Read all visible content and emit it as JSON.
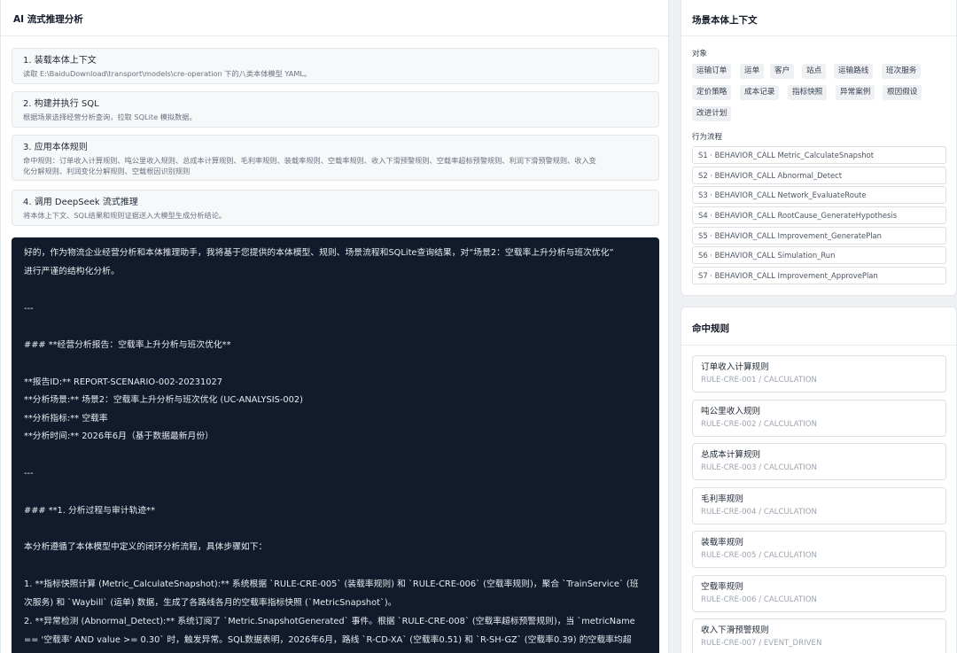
{
  "left": {
    "title": "AI 流式推理分析",
    "steps": [
      {
        "title": "1. 装载本体上下文",
        "desc": "读取 E:\\BaiduDownload\\transport\\models\\cre-operation 下的八类本体模型 YAML。"
      },
      {
        "title": "2. 构建并执行 SQL",
        "desc": "根据场景选择经营分析查询，拉取 SQLite 模拟数据。"
      },
      {
        "title": "3. 应用本体规则",
        "desc": "命中规则：订单收入计算规则、吨公里收入规则、总成本计算规则、毛利率规则、装载率规则、空载率规则、收入下滑预警规则、空载率超标预警规则、利润下滑预警规则、收入变",
        "desc2": "化分解规则、利润变化分解规则、空载根因识别规则"
      },
      {
        "title": "4. 调用 DeepSeek 流式推理",
        "desc": "将本体上下文、SQL结果和规则证据送入大模型生成分析结论。"
      }
    ],
    "output_lines": [
      "好的，作为物流企业经营分析和本体推理助手，我将基于您提供的本体模型、规则、场景流程和SQLite查询结果，对“场景2：空载率上升分析与班次优化”",
      "进行严谨的结构化分析。",
      "---",
      "### **经营分析报告：空载率上升分析与班次优化**",
      "**报告ID:** REPORT-SCENARIO-002-20231027",
      "**分析场景:** 场景2：空载率上升分析与班次优化 (UC-ANALYSIS-002)",
      "**分析指标:** 空载率",
      "**分析时间:** 2026年6月（基于数据最新月份）",
      "---",
      "### **1. 分析过程与审计轨迹**",
      "本分析遵循了本体模型中定义的闭环分析流程，具体步骤如下：",
      "1. **指标快照计算 (Metric_CalculateSnapshot):** 系统根据 `RULE-CRE-005` (装载率规则) 和 `RULE-CRE-006` (空载率规则)，聚合 `TrainService` (班",
      "次服务) 和 `Waybill` (运单) 数据，生成了各路线各月的空载率指标快照 (`MetricSnapshot`)。",
      "2. **异常检测 (Abnormal_Detect):** 系统订阅了 `Metric.SnapshotGenerated` 事件。根据 `RULE-CRE-008` (空载率超标预警规则)，当 `metricName",
      "== '空载率' AND value >= 0.30` 时，触发异常。SQL数据表明，2026年6月，路线 `R-CD-XA` (空载率0.51) 和 `R-SH-GZ` (空载率0.39) 的空载率均超"
    ]
  },
  "context": {
    "title": "场景本体上下文",
    "objects_label": "对象",
    "objects": [
      "运输订单",
      "运单",
      "客户",
      "站点",
      "运输路线",
      "班次服务",
      "定价策略",
      "成本记录",
      "指标快照",
      "异常案例",
      "根因假设",
      "改进计划"
    ],
    "flow_label": "行为流程",
    "flow": [
      "S1 · BEHAVIOR_CALL Metric_CalculateSnapshot",
      "S2 · BEHAVIOR_CALL Abnormal_Detect",
      "S3 · BEHAVIOR_CALL Network_EvaluateRoute",
      "S4 · BEHAVIOR_CALL RootCause_GenerateHypothesis",
      "S5 · BEHAVIOR_CALL Improvement_GeneratePlan",
      "S6 · BEHAVIOR_CALL Simulation_Run",
      "S7 · BEHAVIOR_CALL Improvement_ApprovePlan"
    ]
  },
  "rules": {
    "title": "命中规则",
    "items": [
      {
        "name": "订单收入计算规则",
        "code": "RULE-CRE-001 / CALCULATION"
      },
      {
        "name": "吨公里收入规则",
        "code": "RULE-CRE-002 / CALCULATION"
      },
      {
        "name": "总成本计算规则",
        "code": "RULE-CRE-003 / CALCULATION"
      },
      {
        "name": "毛利率规则",
        "code": "RULE-CRE-004 / CALCULATION"
      },
      {
        "name": "装载率规则",
        "code": "RULE-CRE-005 / CALCULATION"
      },
      {
        "name": "空载率规则",
        "code": "RULE-CRE-006 / CALCULATION"
      },
      {
        "name": "收入下滑预警规则",
        "code": "RULE-CRE-007 / EVENT_DRIVEN"
      }
    ]
  }
}
